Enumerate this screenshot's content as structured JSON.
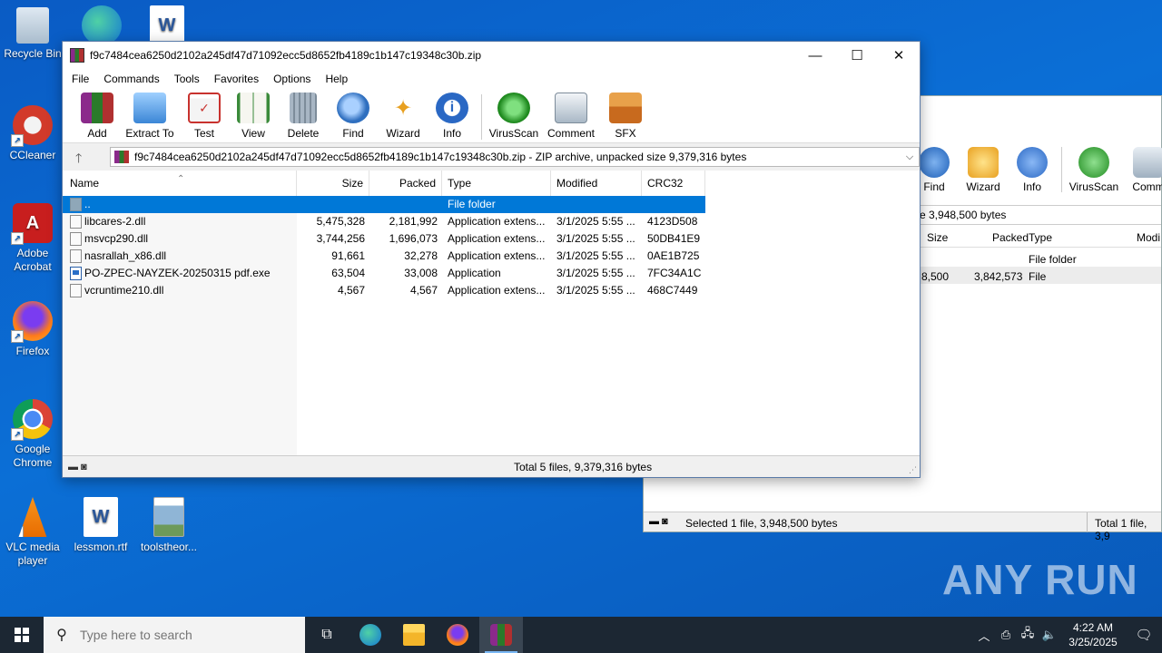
{
  "desktop": {
    "icons": [
      {
        "label": "Recycle Bin"
      },
      {
        "label": "CCleaner"
      },
      {
        "label": "Adobe Acrobat"
      },
      {
        "label": "Firefox"
      },
      {
        "label": "Google Chrome"
      },
      {
        "label": "VLC media player"
      },
      {
        "label": "lessmon.rtf"
      },
      {
        "label": "toolstheor..."
      }
    ],
    "watermark": "ANY RUN"
  },
  "bg_window": {
    "toolbar": [
      "Find",
      "Wizard",
      "Info",
      "VirusScan",
      "Comm"
    ],
    "address_fragment": "e 3,948,500 bytes",
    "columns": [
      "Size",
      "Packed",
      "Type",
      "Modi"
    ],
    "rows": [
      {
        "size": "",
        "packed": "",
        "type": "File folder"
      },
      {
        "size": "8,500",
        "packed": "3,842,573",
        "type": "File"
      }
    ],
    "status_left": "Selected 1 file, 3,948,500 bytes",
    "status_right": "Total 1 file, 3,9"
  },
  "window": {
    "title": "f9c7484cea6250d2102a245df47d71092ecc5d8652fb4189c1b147c19348c30b.zip",
    "controls": {
      "minimize": "—",
      "maximize": "☐",
      "close": "✕"
    },
    "menu": [
      "File",
      "Commands",
      "Tools",
      "Favorites",
      "Options",
      "Help"
    ],
    "toolbar": [
      {
        "label": "Add",
        "color": "#7a3a9a"
      },
      {
        "label": "Extract To",
        "color": "#3b86d6"
      },
      {
        "label": "Test",
        "color": "#c8322e"
      },
      {
        "label": "View",
        "color": "#3a8a3a"
      },
      {
        "label": "Delete",
        "color": "#8a99a8"
      },
      {
        "label": "Find",
        "color": "#2f6fbf"
      },
      {
        "label": "Wizard",
        "color": "#e8a020"
      },
      {
        "label": "Info",
        "color": "#2a68c4"
      },
      {
        "label": "VirusScan",
        "color": "#2f9a2f"
      },
      {
        "label": "Comment",
        "color": "#8a9aa8"
      },
      {
        "label": "SFX",
        "color": "#e0641e"
      }
    ],
    "address": "f9c7484cea6250d2102a245df47d71092ecc5d8652fb4189c1b147c19348c30b.zip - ZIP archive, unpacked size 9,379,316 bytes",
    "columns": {
      "name": "Name",
      "size": "Size",
      "packed": "Packed",
      "type": "Type",
      "modified": "Modified",
      "crc": "CRC32"
    },
    "files": [
      {
        "name": "..",
        "size": "",
        "packed": "",
        "type": "File folder",
        "modified": "",
        "crc": "",
        "icon": "folder-icon",
        "selected": true
      },
      {
        "name": "libcares-2.dll",
        "size": "5,475,328",
        "packed": "2,181,992",
        "type": "Application extens...",
        "modified": "3/1/2025 5:55 ...",
        "crc": "4123D508",
        "icon": "dll-file-icon",
        "selected": false
      },
      {
        "name": "msvcp290.dll",
        "size": "3,744,256",
        "packed": "1,696,073",
        "type": "Application extens...",
        "modified": "3/1/2025 5:55 ...",
        "crc": "50DB41E9",
        "icon": "dll-file-icon",
        "selected": false
      },
      {
        "name": "nasrallah_x86.dll",
        "size": "91,661",
        "packed": "32,278",
        "type": "Application extens...",
        "modified": "3/1/2025 5:55 ...",
        "crc": "0AE1B725",
        "icon": "dll-file-icon",
        "selected": false
      },
      {
        "name": "PO-ZPEC-NAYZEK-20250315 pdf.exe",
        "size": "63,504",
        "packed": "33,008",
        "type": "Application",
        "modified": "3/1/2025 5:55 ...",
        "crc": "7FC34A1C",
        "icon": "exe-file-icon",
        "selected": false
      },
      {
        "name": "vcruntime210.dll",
        "size": "4,567",
        "packed": "4,567",
        "type": "Application extens...",
        "modified": "3/1/2025 5:55 ...",
        "crc": "468C7449",
        "icon": "dll-file-icon",
        "selected": false
      }
    ],
    "status": "Total 5 files, 9,379,316 bytes"
  },
  "taskbar": {
    "search_placeholder": "Type here to search",
    "time": "4:22 AM",
    "date": "3/25/2025"
  }
}
